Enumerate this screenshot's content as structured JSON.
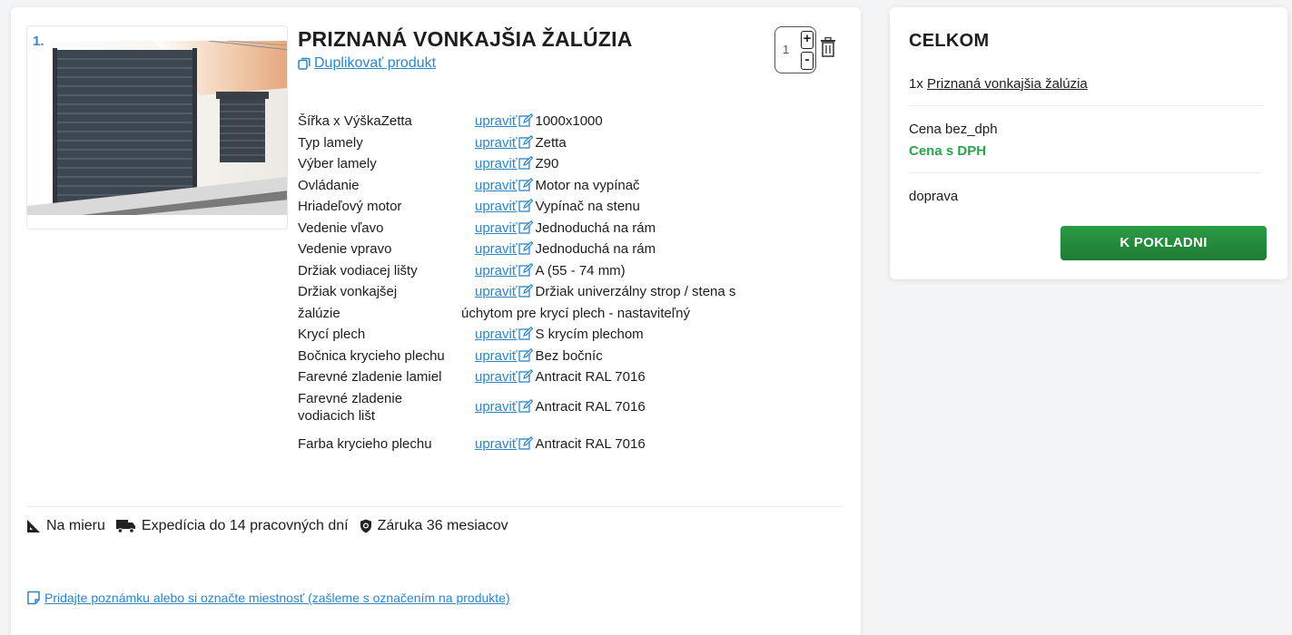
{
  "product": {
    "index": "1.",
    "title": "PRIZNANÁ VONKAJŠIA ŽALÚZIA",
    "duplicate_label": "Duplikovať produkt",
    "quantity": "1",
    "plus_label": "+",
    "minus_label": "-",
    "edit_label": "upraviť",
    "params": [
      {
        "label": "Šířka x VýškaZetta",
        "value": "1000x1000"
      },
      {
        "label": "Typ lamely",
        "value": "Zetta"
      },
      {
        "label": "Výber lamely",
        "value": "Z90"
      },
      {
        "label": "Ovládanie",
        "value": "Motor na vypínač"
      },
      {
        "label": "Hriadeľový motor",
        "value": "Vypínač na stenu"
      },
      {
        "label": "Vedenie vľavo",
        "value": "Jednoduchá na rám"
      },
      {
        "label": "Vedenie vpravo",
        "value": "Jednoduchá na rám"
      },
      {
        "label": "Držiak vodiacej lišty",
        "value": "A (55 - 74 mm)"
      },
      {
        "label": "Držiak vonkajšej",
        "value": "Držiak univerzálny strop / stena s"
      },
      {
        "label": "žalúzie",
        "value": "úchytom pre krycí plech - nastaviteľný"
      },
      {
        "label": "Krycí plech",
        "value": "S krycím plechom"
      },
      {
        "label": "Bočnica krycieho plechu",
        "value": "Bez bočníc"
      },
      {
        "label": "Farevné zladenie lamiel",
        "value": "Antracit RAL 7016"
      },
      {
        "label": "Farevné zladenie vodiacich lišt",
        "value": "Antracit RAL 7016"
      },
      {
        "label": "Farba krycieho plechu",
        "value": "Antracit RAL 7016"
      }
    ],
    "features": {
      "measure": "Na mieru",
      "shipping": "Expedícia do 14 pracovných dní",
      "warranty": "Záruka 36 mesiacov"
    },
    "note_link": "Pridajte poznámku alebo si označte miestnosť (zašleme s označením na produkte)"
  },
  "summary": {
    "title": "CELKOM",
    "item_qty": "1x",
    "item_name": "Priznaná vonkajšia žalúzia",
    "price_no_vat": "Cena bez_dph",
    "price_vat": "Cena s DPH",
    "shipping": "doprava",
    "checkout": "K POKLADNI"
  },
  "colors": {
    "link": "#2b86c9",
    "accent_green": "#2aa44a",
    "button_green": "#1e7c34"
  }
}
